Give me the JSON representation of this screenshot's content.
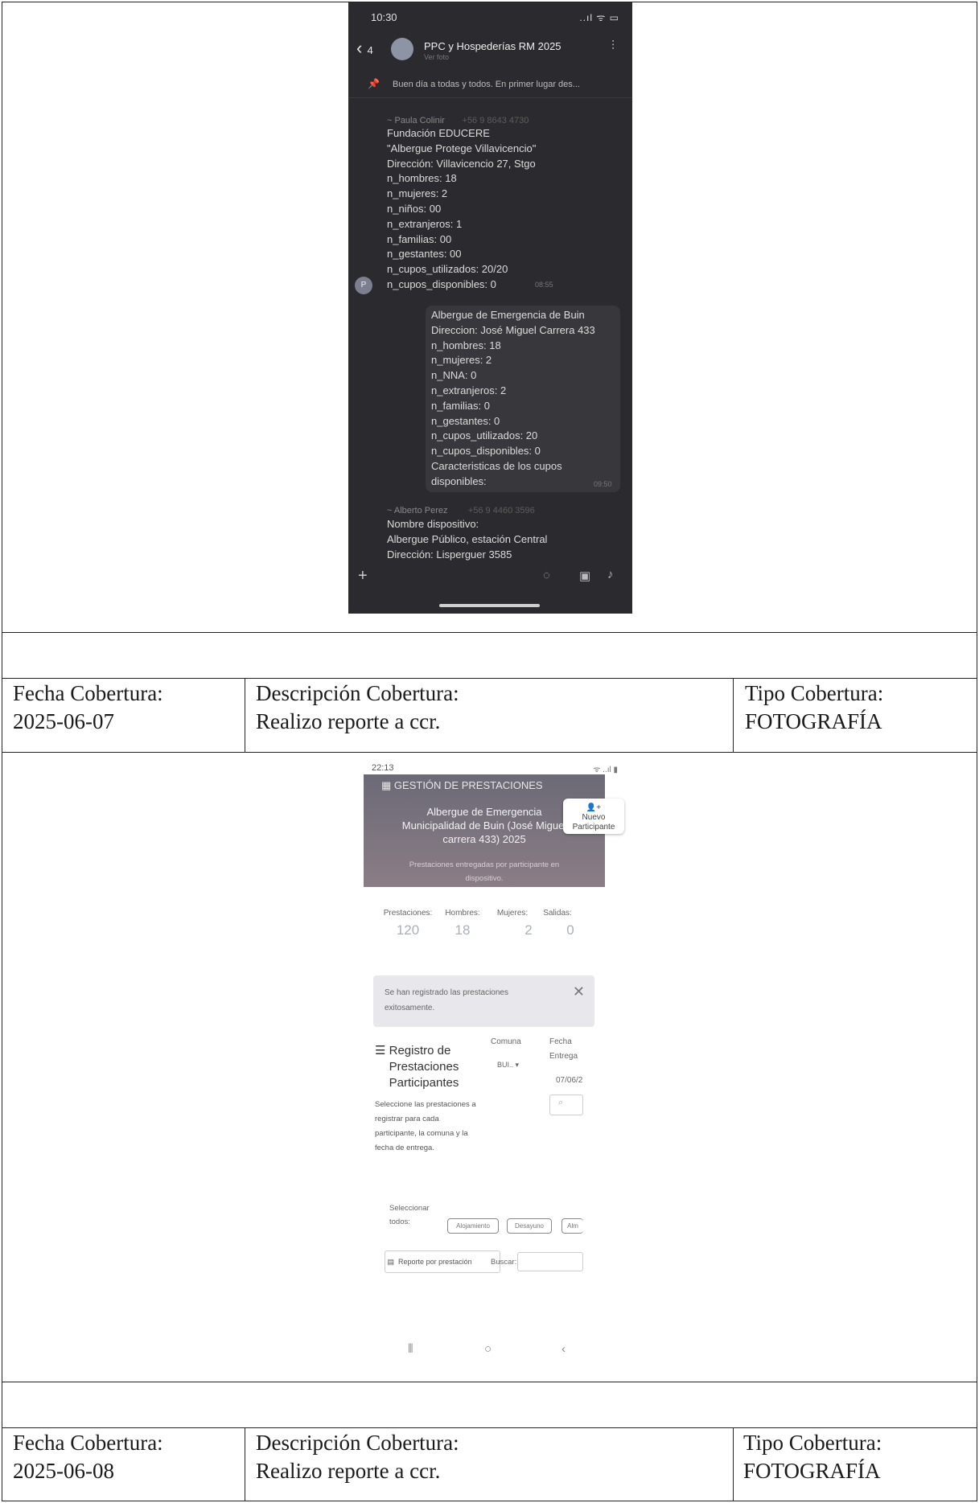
{
  "phone_whatsapp": {
    "status_time": "10:30",
    "status_icons": "..ıl ᯤ ▭",
    "back_count": "4",
    "chat_title": "PPC y Hospederías RM 2025",
    "chat_subtitle": "Ver foto",
    "pinned_text": "Buen día a todas y todos. En primer lugar des...",
    "msg1_sender": "~ Paula Colinir",
    "msg1_phone": "+56 9 8643 4730",
    "msg1_lines": [
      "Fundación EDUCERE",
      "\"Albergue Protege Villavicencio\"",
      "Dirección: Villavicencio 27, Stgo",
      "n_hombres: 18",
      "n_mujeres: 2",
      "n_niños: 00",
      "n_extranjeros: 1",
      "n_familias: 00",
      "n_gestantes: 00",
      "n_cupos_utilizados: 20/20",
      "n_cupos_disponibles: 0"
    ],
    "msg1_time": "08:55",
    "msg2_lines": [
      "Albergue de Emergencia de Buin",
      "Direccion: José Miguel Carrera 433",
      "n_hombres: 18",
      "n_mujeres: 2",
      "n_NNA: 0",
      "n_extranjeros: 2",
      "n_familias: 0",
      "n_gestantes: 0",
      "n_cupos_utilizados: 20",
      "n_cupos_disponibles: 0",
      "Caracteristicas de los cupos",
      "disponibles:"
    ],
    "msg2_time": "09:50",
    "msg3_sender": "~ Alberto Perez",
    "msg3_phone": "+56 9 4460 3596",
    "msg3_lines": [
      "Nombre dispositivo:",
      "Albergue Público, estación Central",
      "Dirección: Lisperguer 3585"
    ]
  },
  "spacer_rows": [
    "",
    ""
  ],
  "rows": [
    {
      "fecha_label": "Fecha Cobertura:",
      "fecha_value": "2025-06-07",
      "desc_label": "Descripción Cobertura:",
      "desc_value": "Realizo reporte a ccr.",
      "tipo_label": "Tipo Cobertura:",
      "tipo_value": "FOTOGRAFÍA"
    },
    {
      "fecha_label": "Fecha Cobertura:",
      "fecha_value": "2025-06-08",
      "desc_label": "Descripción Cobertura:",
      "desc_value": "Realizo reporte a ccr.",
      "tipo_label": "Tipo Cobertura:",
      "tipo_value": "FOTOGRAFÍA"
    }
  ],
  "phone_app": {
    "status_time": "22:13",
    "status_right": "ᯤ ..ıl ▮",
    "app_header": "GESTIÓN DE PRESTACIONES",
    "title": "Albergue de Emergencia Municipalidad de Buin (José Miguel carrera 433) 2025",
    "subtitle": "Prestaciones entregadas por participante en dispositivo.",
    "new_button": "Nuevo Participante",
    "stats": [
      {
        "label": "Prestaciones:",
        "value": "120"
      },
      {
        "label": "Hombres:",
        "value": "18"
      },
      {
        "label": "Mujeres:",
        "value": "2"
      },
      {
        "label": "Salidas:",
        "value": "0"
      }
    ],
    "alert_text": "Se han registrado las prestaciones exitosamente.",
    "section_title": "Registro de Prestaciones Participantes",
    "section_desc": "Seleccione las prestaciones a registrar para cada participante, la comuna y la fecha de entrega.",
    "comuna_label": "Comuna",
    "comuna_value": "BUI..",
    "fecha_label": "Fecha Entrega",
    "fecha_value": "07/06/2",
    "select_all_label": "Seleccionar todos:",
    "chips": [
      "Alojamiento",
      "Desayuno",
      "Alm"
    ],
    "report_button": "Reporte por prestación",
    "search_label": "Buscar:"
  }
}
